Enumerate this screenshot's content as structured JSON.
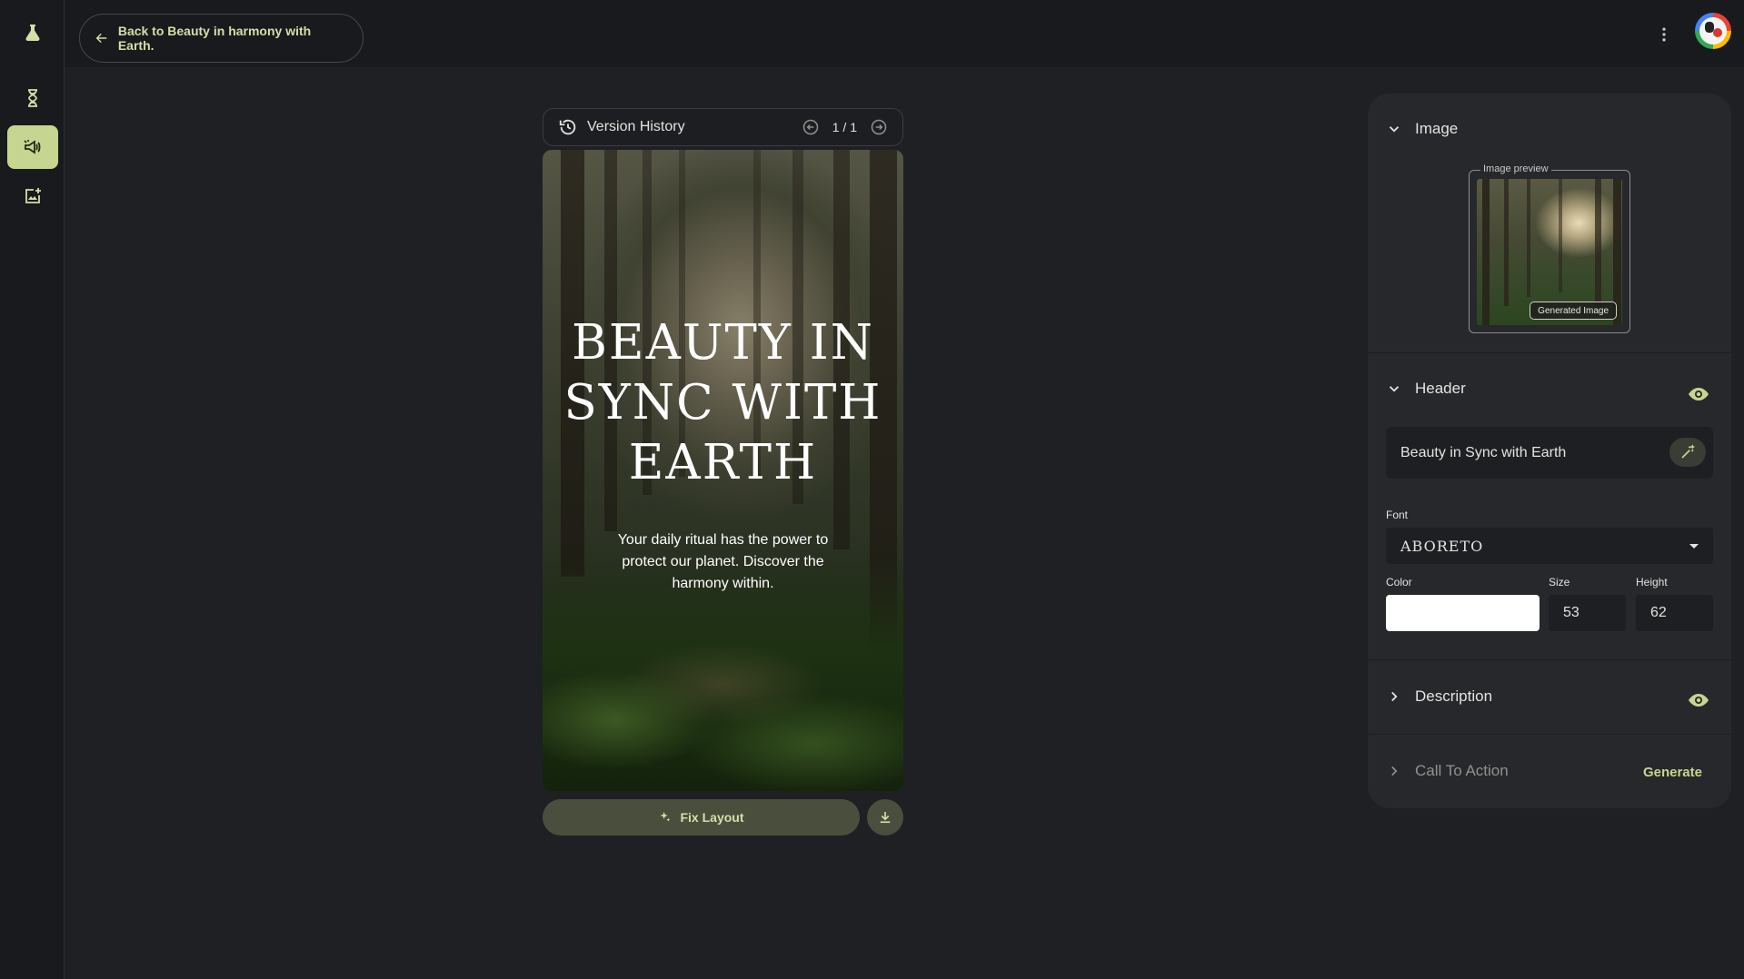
{
  "topbar": {
    "back_label": "Back to Beauty in harmony with Earth."
  },
  "version_history": {
    "title": "Version History",
    "page": "1 / 1"
  },
  "canvas": {
    "header": "Beauty in Sync with Earth",
    "description": "Your daily ritual has the power to protect our planet. Discover the harmony within."
  },
  "actions": {
    "fix_layout": "Fix Layout"
  },
  "panel": {
    "image": {
      "title": "Image",
      "preview_label": "Image preview",
      "badge": "Generated Image"
    },
    "header": {
      "title": "Header",
      "value": "Beauty in Sync with Earth",
      "font_label": "Font",
      "font_value": "ABORETO",
      "color_label": "Color",
      "color_value": "#ffffff",
      "size_label": "Size",
      "size_value": "53",
      "height_label": "Height",
      "height_value": "62"
    },
    "description": {
      "title": "Description"
    },
    "cta": {
      "title": "Call To Action",
      "generate": "Generate"
    }
  },
  "colors": {
    "accent": "#c6d58f",
    "accent_text": "#d4dfa7",
    "background": "#1e2023",
    "panel": "#26282c"
  },
  "icons": {
    "rail": [
      "flask-icon",
      "dna-icon",
      "campaign-icon",
      "add-image-icon"
    ],
    "topbar": [
      "arrow-back-icon",
      "more-vert-icon"
    ],
    "version": [
      "history-icon",
      "arrow-circle-left-icon",
      "arrow-circle-right-icon"
    ],
    "panel": [
      "chevron-down-icon",
      "chevron-right-icon",
      "eye-icon",
      "magic-wand-icon"
    ],
    "actions": [
      "sparkle-icon",
      "download-icon"
    ]
  }
}
